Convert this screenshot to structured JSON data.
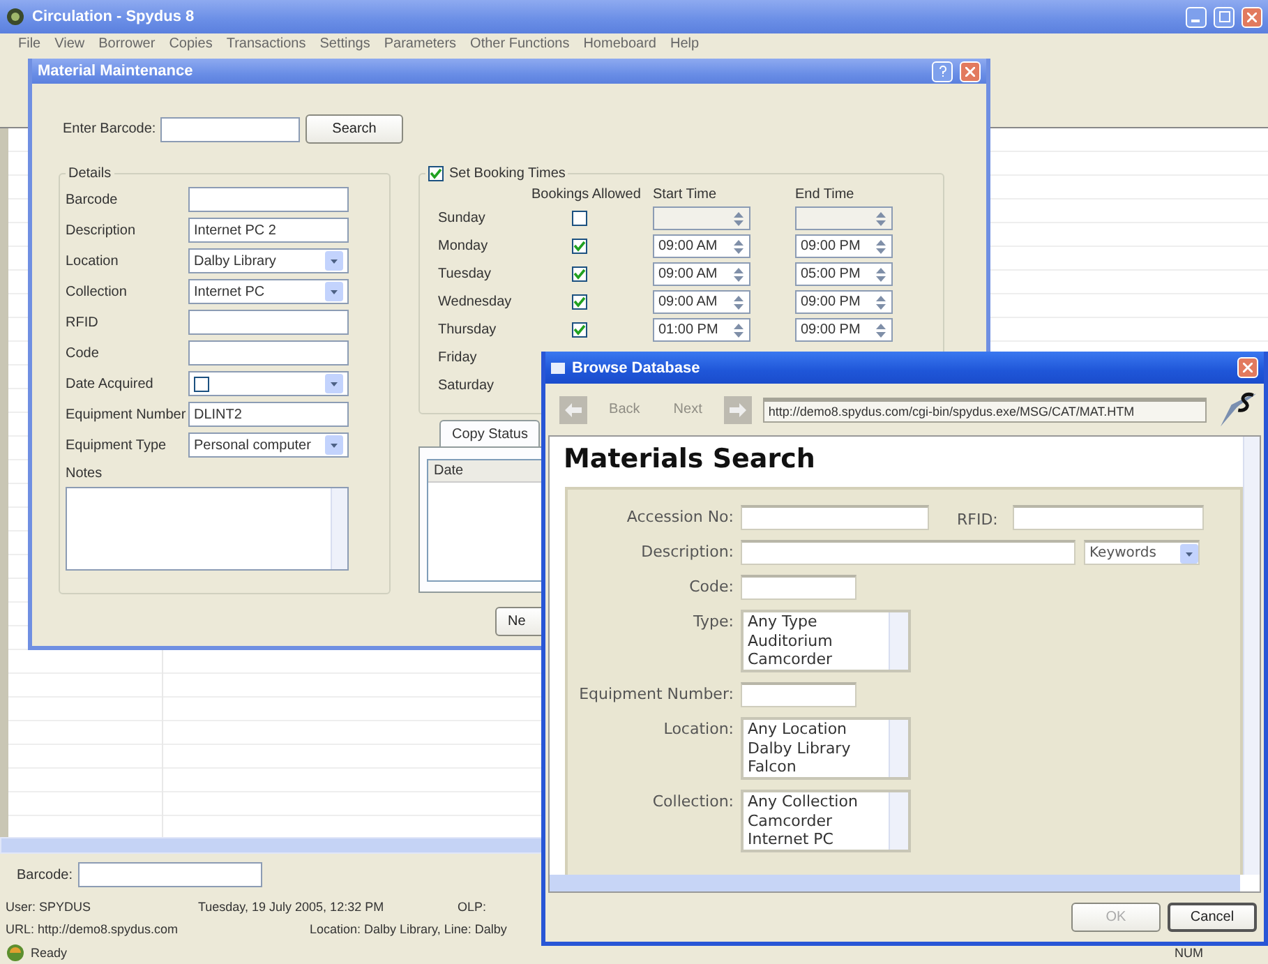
{
  "app_window": {
    "title": "Circulation - Spydus 8",
    "menu": [
      "File",
      "View",
      "Borrower",
      "Copies",
      "Transactions",
      "Settings",
      "Parameters",
      "Other Functions",
      "Homeboard",
      "Help"
    ],
    "barcode_label": "Barcode:",
    "status_bar": {
      "user": "User: SPYDUS",
      "date": "Tuesday, 19 July 2005, 12:32 PM",
      "olp": "OLP:",
      "url": "URL: http://demo8.spydus.com",
      "location": "Location: Dalby Library, Line: Dalby",
      "ready": "Ready",
      "num": "NUM"
    }
  },
  "material_dialog": {
    "title": "Material Maintenance",
    "barcode_label": "Enter Barcode:",
    "search_button": "Search",
    "details_title": "Details",
    "fields": [
      {
        "label": "Barcode",
        "kind": "text"
      },
      {
        "label": "Description",
        "kind": "text",
        "value": "Internet PC 2"
      },
      {
        "label": "Location",
        "kind": "select",
        "value": "Dalby Library"
      },
      {
        "label": "Collection",
        "kind": "select",
        "value": "Internet PC"
      },
      {
        "label": "RFID",
        "kind": "text"
      },
      {
        "label": "Code",
        "kind": "text"
      },
      {
        "label": "Date Acquired",
        "kind": "date",
        "checked": false
      },
      {
        "label": "Equipment Number",
        "kind": "text",
        "value": "DLINT2"
      },
      {
        "label": "Equipment Type",
        "kind": "select",
        "value": "Personal computer"
      }
    ],
    "notes_label": "Notes",
    "booking": {
      "label": "Set Booking Times",
      "checked": true,
      "columns": [
        "Bookings Allowed",
        "Start Time",
        "End Time"
      ],
      "days": [
        {
          "day": "Sunday",
          "allowed": false
        },
        {
          "day": "Monday",
          "allowed": true,
          "start": "09:00 AM",
          "end": "09:00 PM"
        },
        {
          "day": "Tuesday",
          "allowed": true,
          "start": "09:00 AM",
          "end": "05:00 PM"
        },
        {
          "day": "Wednesday",
          "allowed": true,
          "start": "09:00 AM",
          "end": "09:00 PM"
        },
        {
          "day": "Thursday",
          "allowed": true,
          "start": "01:00 PM",
          "end": "09:00 PM"
        },
        {
          "day": "Friday"
        },
        {
          "day": "Saturday"
        }
      ]
    },
    "tabs": [
      {
        "label": "Copy Status",
        "selected": true
      }
    ],
    "table_columns": [
      "Date"
    ],
    "buttons": [
      "Ne"
    ]
  },
  "browse_window": {
    "title": "Browse Database",
    "back": "Back",
    "next": "Next",
    "url": "http://demo8.spydus.com/cgi-bin/spydus.exe/MSG/CAT/MAT.HTM",
    "heading": "Materials Search",
    "rows": [
      {
        "label": "Accession No:",
        "kind": "text",
        "extra_label": "RFID:"
      },
      {
        "label": "Description:",
        "kind": "text_select",
        "select": "Keywords"
      },
      {
        "label": "Code:",
        "kind": "short"
      },
      {
        "label": "Type:",
        "kind": "list",
        "options": [
          "Any Type",
          "Auditorium",
          "Camcorder"
        ]
      },
      {
        "label": "Equipment Number:",
        "kind": "short"
      },
      {
        "label": "Location:",
        "kind": "list",
        "options": [
          "Any Location",
          "Dalby Library",
          "Falcon"
        ]
      },
      {
        "label": "Collection:",
        "kind": "list",
        "options": [
          "Any Collection",
          "Camcorder",
          "Internet PC"
        ]
      }
    ],
    "buttons": [
      {
        "label": "OK",
        "disabled": true
      },
      {
        "label": "Cancel",
        "disabled": false
      }
    ]
  }
}
